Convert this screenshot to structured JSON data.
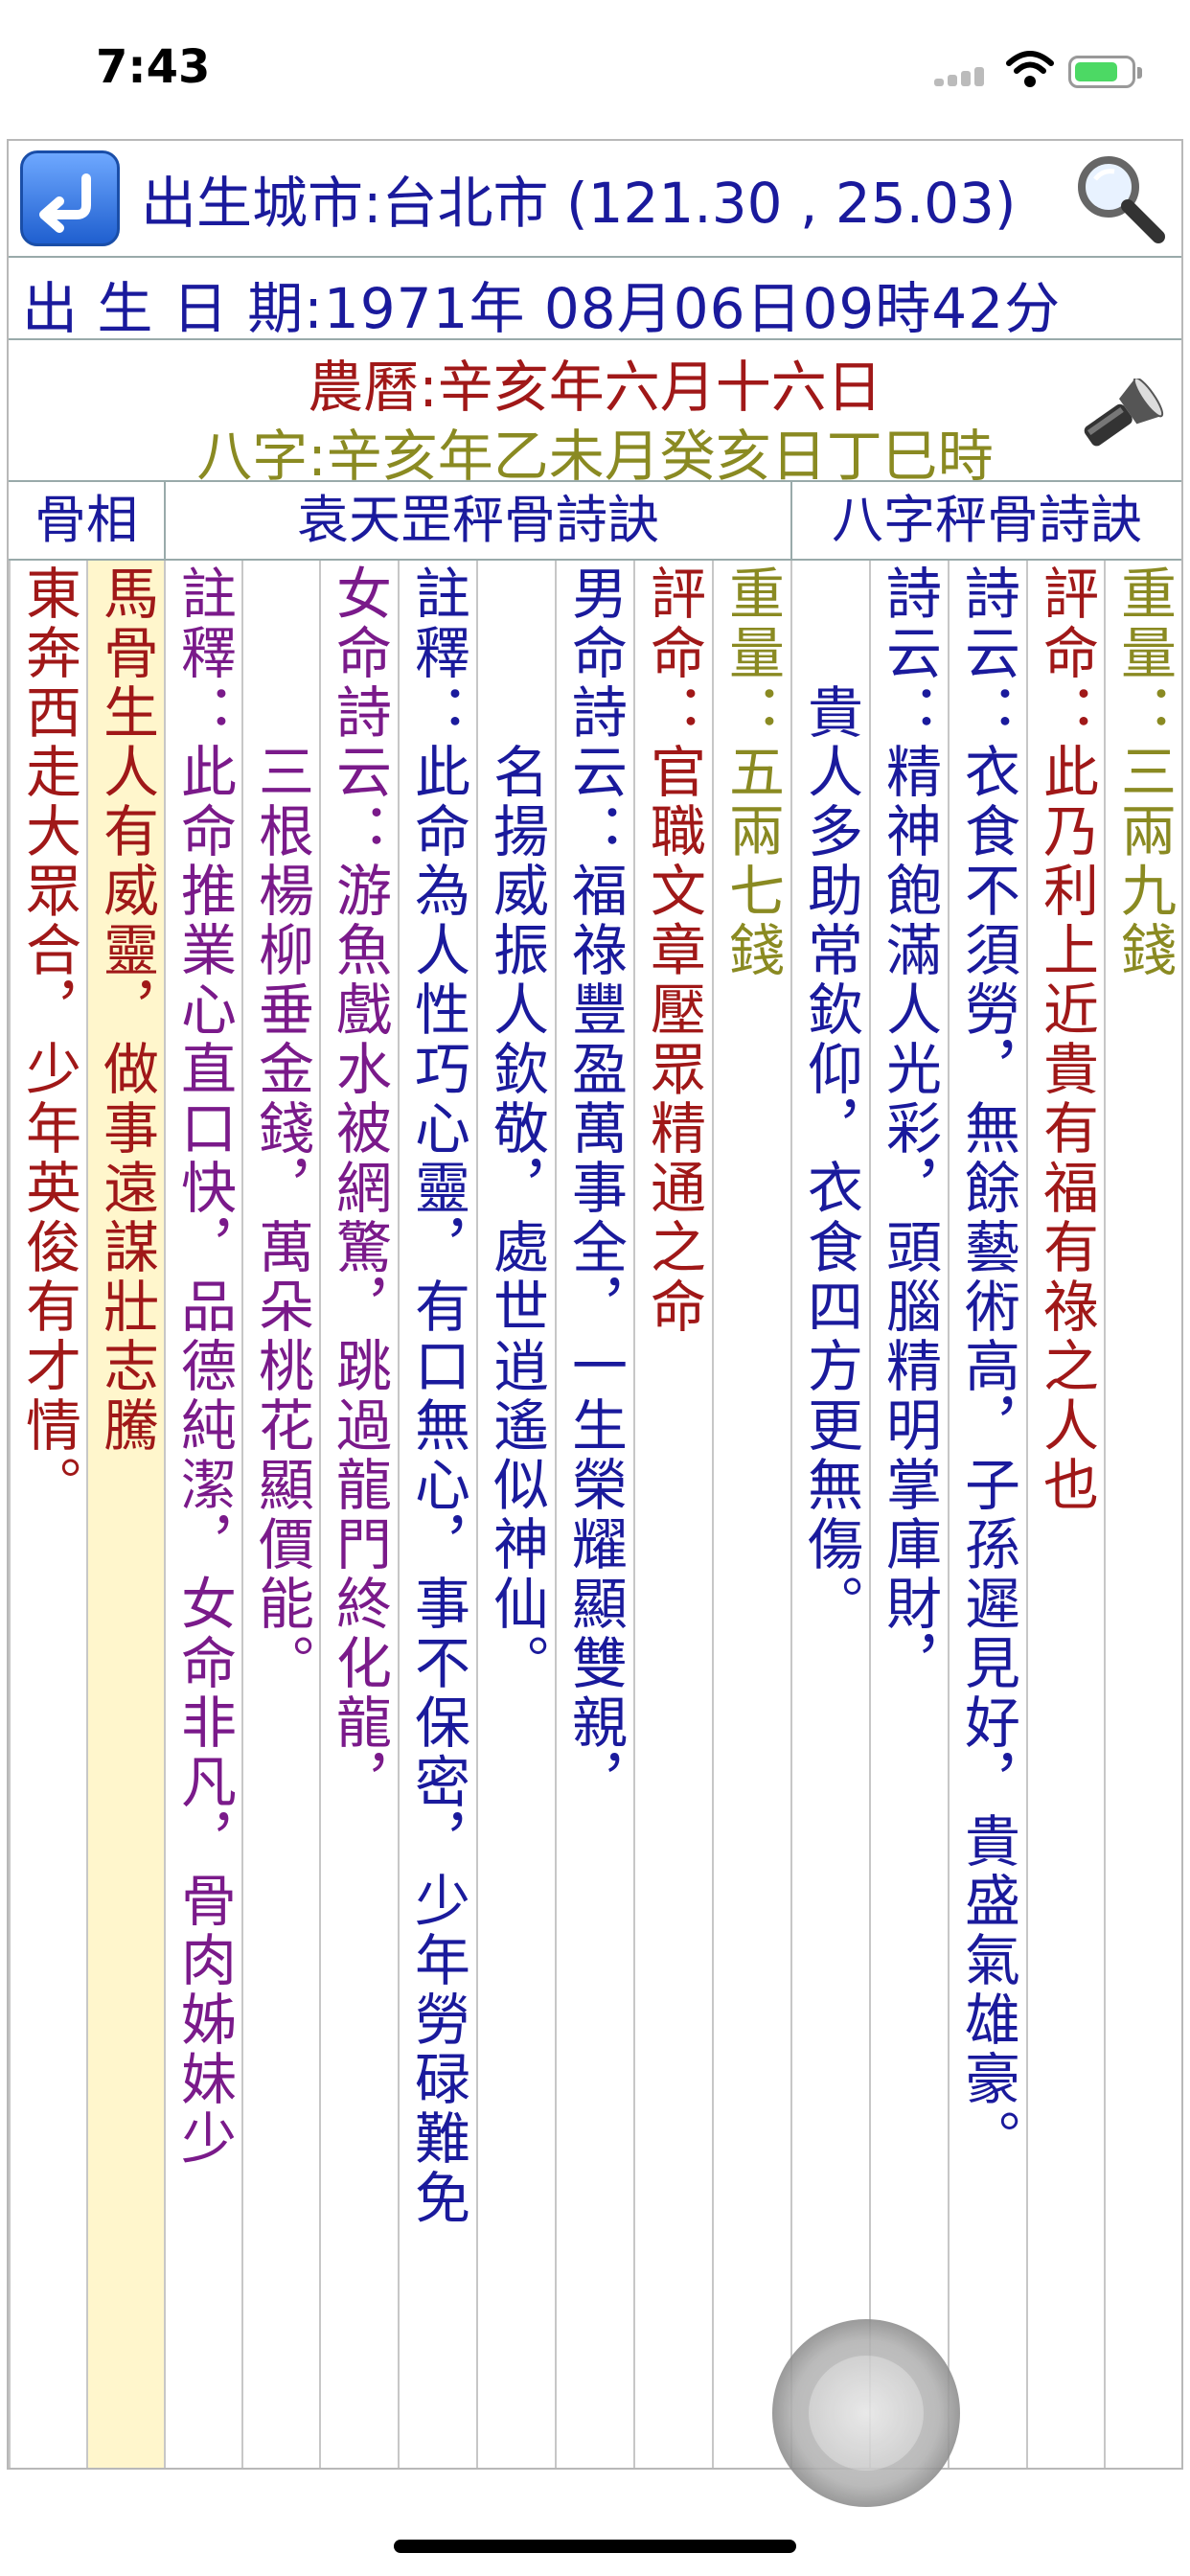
{
  "status_bar": {
    "time": "7:43"
  },
  "header": {
    "city_text": "出生城市:台北市 (121.30 , 25.03)",
    "date_text": "出 生 日 期:1971年 08月06日09時42分",
    "lunar_text": "農曆:辛亥年六月十六日",
    "bazi_text": "八字:辛亥年乙未月癸亥日丁巳時"
  },
  "table_headers": {
    "col1": "骨相",
    "col2": "袁天罡秤骨詩訣",
    "col3": "八字秤骨詩訣"
  },
  "columns": [
    {
      "text": "東奔西走大眾合，少年英俊有才情。",
      "color": "#a01818"
    },
    {
      "text": "馬骨生人有威靈，做事遠謀壯志騰",
      "color": "#a01818"
    },
    {
      "text": "註釋：此命推業心直口快，品德純潔，女命非凡，骨肉姊妹少",
      "color": "#7a1a8a"
    },
    {
      "text": "　　　三根楊柳垂金錢，萬朵桃花顯價能。",
      "color": "#7a1a8a"
    },
    {
      "text": "女命詩云：游魚戲水被網驚，跳過龍門終化龍，",
      "color": "#7a1a8a"
    },
    {
      "text": "註釋：此命為人性巧心靈，有口無心，事不保密，少年勞碌難免",
      "color": "#1a1a9c"
    },
    {
      "text": "　　　名揚威振人欽敬，處世逍遙似神仙。",
      "color": "#1a1a9c"
    },
    {
      "text": "男命詩云：福祿豐盈萬事全，一生榮耀顯雙親，",
      "color": "#1a1a9c"
    },
    {
      "text": "評命：官職文章壓眾精通之命",
      "color": "#a01818"
    },
    {
      "text": "重量：五兩七錢",
      "color": "#8a8a22"
    },
    {
      "text": "　　貴人多助常欽仰，衣食四方更無傷。",
      "color": "#1a1a9c"
    },
    {
      "text": "詩云：精神飽滿人光彩，頭腦精明掌庫財，",
      "color": "#1a1a9c"
    },
    {
      "text": "詩云：衣食不須勞，無餘藝術高，子孫遲見好，貴盛氣雄豪。",
      "color": "#1a1a9c"
    },
    {
      "text": "評命：此乃利上近貴有福有祿之人也",
      "color": "#a01818"
    },
    {
      "text": "重量：三兩九錢",
      "color": "#8a8a22"
    }
  ]
}
